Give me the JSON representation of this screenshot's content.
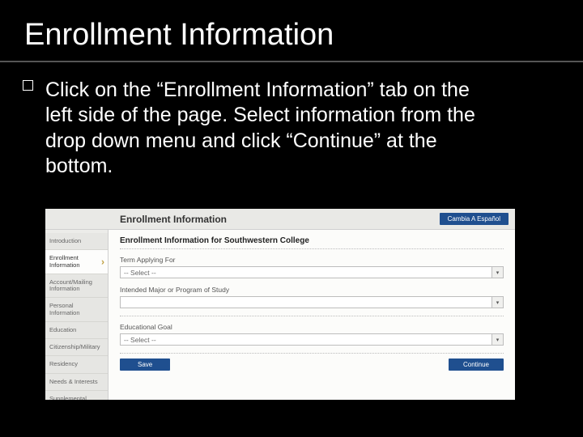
{
  "slide": {
    "title": "Enrollment Information",
    "body": "Click on the “Enrollment Information” tab on the left side of the page.  Select information from the drop down menu and click “Continue” at the bottom."
  },
  "screenshot": {
    "header_title": "Enrollment Information",
    "header_button": "Cambia A Español",
    "sidebar": [
      "Introduction",
      "Enrollment Information",
      "Account/Mailing Information",
      "Personal Information",
      "Education",
      "Citizenship/Military",
      "Residency",
      "Needs & Interests",
      "Supplemental Questions"
    ],
    "active_index": 1,
    "section_heading": "Enrollment Information for Southwestern College",
    "fields": {
      "term_label": "Term Applying For",
      "term_value": "-- Select --",
      "major_label": "Intended Major or Program of Study",
      "major_value": "",
      "goal_label": "Educational Goal",
      "goal_value": "-- Select --"
    },
    "buttons": {
      "save": "Save",
      "continue": "Continue"
    }
  }
}
